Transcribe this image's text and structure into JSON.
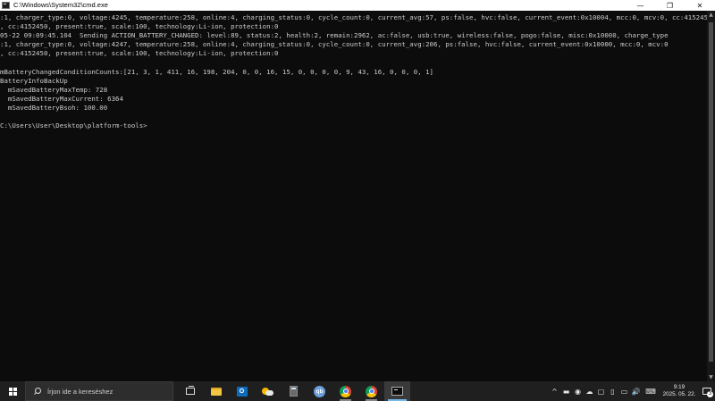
{
  "window": {
    "title": "C:\\Windows\\System32\\cmd.exe",
    "minimize_glyph": "—",
    "maximize_glyph": "❐",
    "close_glyph": "✕"
  },
  "console": {
    "lines": [
      ":1, charger_type:0, voltage:4245, temperature:258, online:4, charging_status:0, cycle_count:0, current_avg:57, ps:false, hvc:false, current_event:0x10004, mcc:0, mcv:0, cc:4152450, present:true, scale:100, technology:Li-ion, protection:0",
      ", cc:4152450, present:true, scale:100, technology:Li-ion, protection:0",
      "05-22 09:09:45.104  Sending ACTION_BATTERY_CHANGED: level:89, status:2, health:2, remain:2962, ac:false, usb:true, wireless:false, pogo:false, misc:0x10000, charge_type",
      ":1, charger_type:0, voltage:4247, temperature:258, online:4, charging_status:0, cycle_count:0, current_avg:206, ps:false, hvc:false, current_event:0x10000, mcc:0, mcv:0",
      ", cc:4152450, present:true, scale:100, technology:Li-ion, protection:0",
      "",
      "mBatteryChangedConditionCounts:[21, 3, 1, 411, 16, 198, 204, 0, 0, 16, 15, 0, 0, 0, 0, 9, 43, 16, 0, 0, 0, 1]",
      "BatteryInfoBackUp",
      "  mSavedBatteryMaxTemp: 728",
      "  mSavedBatteryMaxCurrent: 6364",
      "  mSavedBatteryBsoh: 100.00",
      "",
      "C:\\Users\\User\\Desktop\\platform-tools>"
    ]
  },
  "taskbar": {
    "search_placeholder": "Írjon ide a kereséshez",
    "outlook_letter": "O",
    "qb_label": "qb",
    "tray_chevron": "^",
    "tray_volume": "🔊",
    "clock_time": "9:19",
    "clock_date": "2025. 05. 22.",
    "notification_count": "3"
  }
}
